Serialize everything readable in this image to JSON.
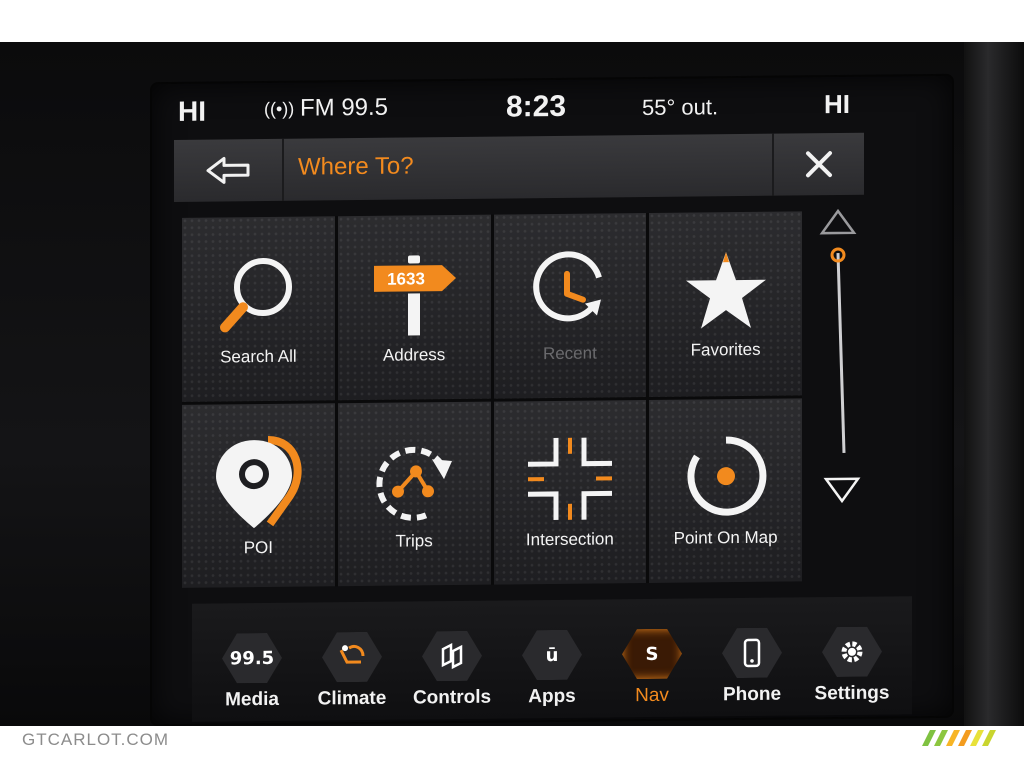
{
  "status": {
    "hi_left": "HI",
    "radio": "FM 99.5",
    "time": "8:23",
    "temp": "55° out.",
    "hi_right": "HI"
  },
  "titlebar": {
    "title": "Where To?"
  },
  "tiles": [
    {
      "label": "Search All",
      "icon": "search-icon"
    },
    {
      "label": "Address",
      "sign": "1633",
      "icon": "address-sign-icon"
    },
    {
      "label": "Recent",
      "icon": "recent-clock-icon"
    },
    {
      "label": "Favorites",
      "icon": "star-icon"
    },
    {
      "label": "POI",
      "icon": "poi-pin-icon"
    },
    {
      "label": "Trips",
      "icon": "trips-icon"
    },
    {
      "label": "Intersection",
      "icon": "intersection-icon"
    },
    {
      "label": "Point On Map",
      "icon": "target-icon"
    }
  ],
  "nav": [
    {
      "label": "Media",
      "badge": "99.5"
    },
    {
      "label": "Climate"
    },
    {
      "label": "Controls"
    },
    {
      "label": "Apps",
      "badge": "ū"
    },
    {
      "label": "Nav",
      "badge": "S"
    },
    {
      "label": "Phone"
    },
    {
      "label": "Settings"
    }
  ],
  "colors": {
    "accent": "#f28a1e",
    "text": "#f4f4f4",
    "disabled": "#6a6a6d"
  },
  "watermark": "GTCARLOT.COM"
}
